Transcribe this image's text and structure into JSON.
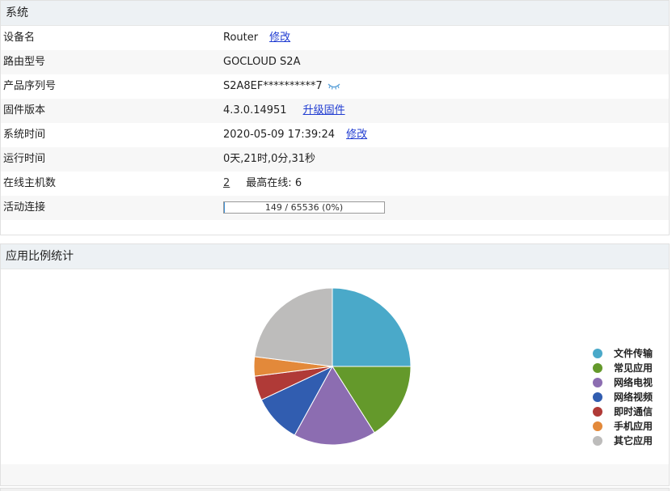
{
  "system": {
    "title": "系统",
    "device_name": {
      "label": "设备名",
      "value": "Router",
      "action": "修改"
    },
    "model": {
      "label": "路由型号",
      "value": "GOCLOUD S2A"
    },
    "serial": {
      "label": "产品序列号",
      "value": "S2A8EF**********7",
      "reveal_icon": "eye-closed-icon"
    },
    "firmware": {
      "label": "固件版本",
      "value": "4.3.0.14951",
      "action": "升级固件"
    },
    "time": {
      "label": "系统时间",
      "value": "2020-05-09 17:39:24",
      "action": "修改"
    },
    "uptime": {
      "label": "运行时间",
      "value": "0天,21时,0分,31秒"
    },
    "hosts": {
      "label": "在线主机数",
      "value": "2",
      "peak_label": "最高在线:",
      "peak_value": "6"
    },
    "connections": {
      "label": "活动连接",
      "text": "149 / 65536 (0%)",
      "used": 149,
      "total": 65536,
      "percent": 0
    }
  },
  "apps": {
    "title": "应用比例统计"
  },
  "chart_data": {
    "type": "pie",
    "title": "",
    "categories": [
      "文件传输",
      "常见应用",
      "网络电视",
      "网络视频",
      "即时通信",
      "手机应用",
      "其它应用"
    ],
    "values": [
      25,
      16,
      17,
      10,
      5,
      4,
      23
    ],
    "colors": [
      "#4aa9c9",
      "#64992b",
      "#8c6db1",
      "#315db0",
      "#b03a37",
      "#e3893a",
      "#bdbcbb"
    ],
    "legend_position": "right"
  }
}
